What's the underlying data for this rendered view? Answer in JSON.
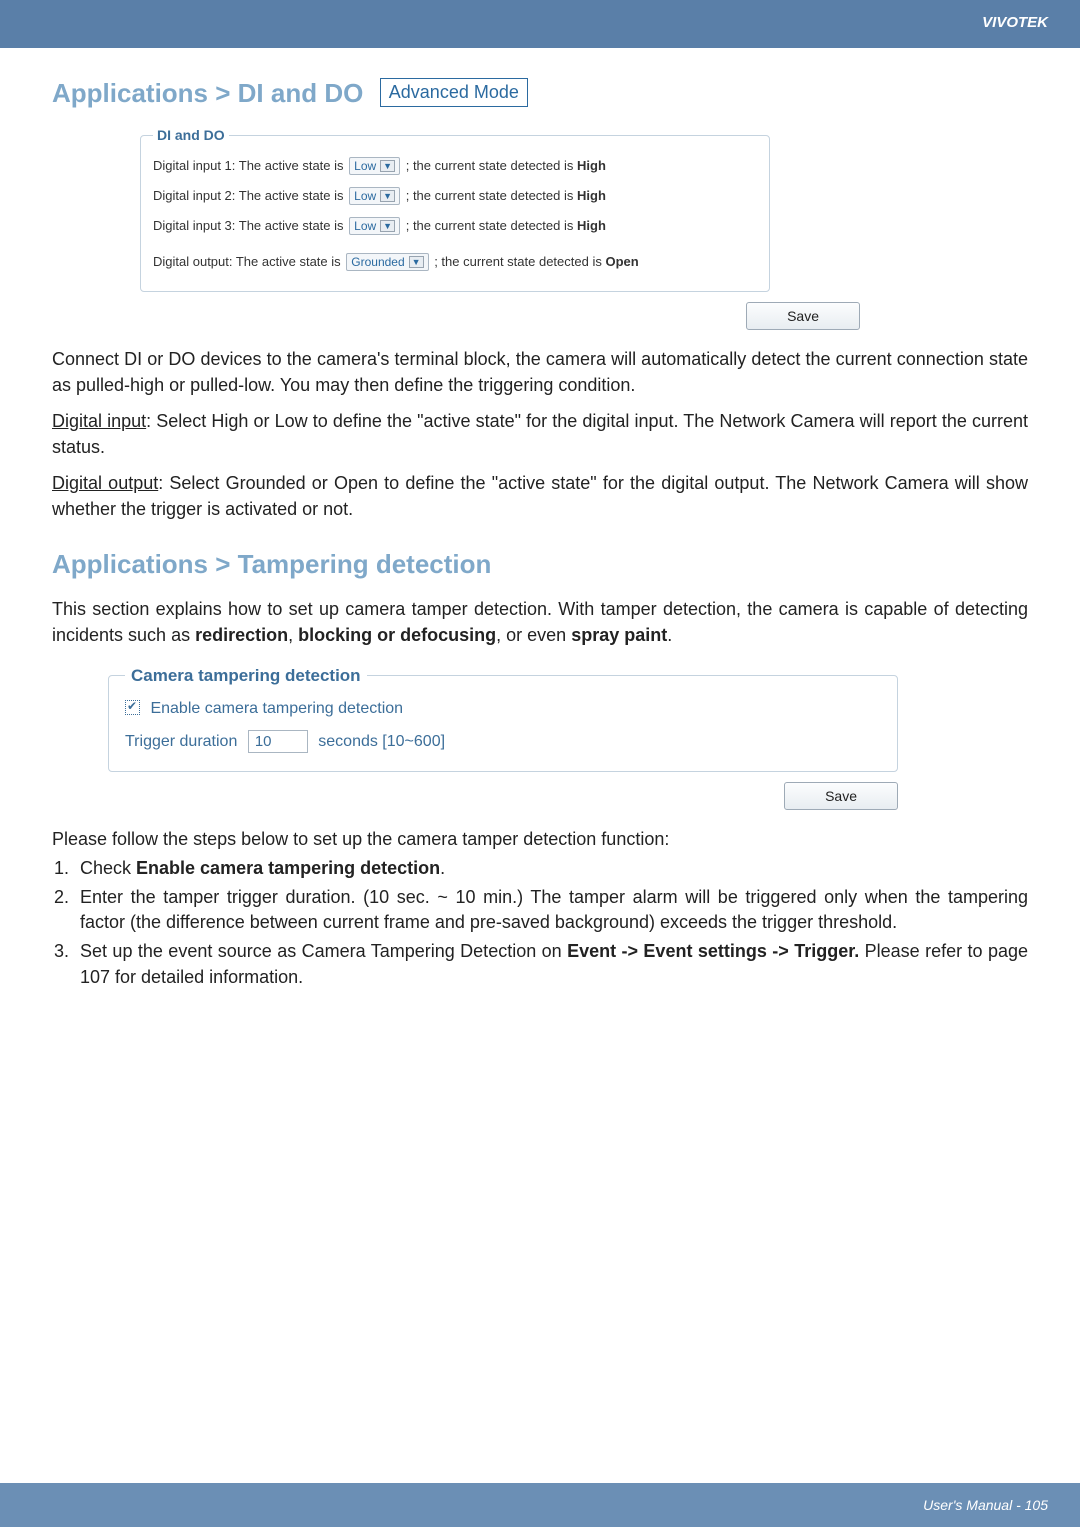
{
  "brand": "VIVOTEK",
  "section1": {
    "breadcrumb": "Applications > DI and DO",
    "mode": "Advanced Mode",
    "legend": "DI and DO",
    "rows": [
      {
        "prefix": "Digital input 1: The active state is",
        "select": "Low",
        "suffix": "; the current state detected is",
        "state": "High"
      },
      {
        "prefix": "Digital input 2: The active state is",
        "select": "Low",
        "suffix": "; the current state detected is",
        "state": "High"
      },
      {
        "prefix": "Digital input 3: The active state is",
        "select": "Low",
        "suffix": "; the current state detected is",
        "state": "High"
      },
      {
        "prefix": "Digital output: The active state is",
        "select": "Grounded",
        "suffix": "; the current state detected is",
        "state": "Open"
      }
    ],
    "save": "Save"
  },
  "para1": "Connect DI or DO devices to the camera's terminal block, the camera will automatically detect the current connection state as pulled-high or pulled-low. You may then define the triggering condition.",
  "para2a": "Digital input",
  "para2b": ": Select High or Low to define the \"active state\" for the digital input. The Network Camera will report the current status.",
  "para3a": "Digital output",
  "para3b": ": Select Grounded or Open to define the \"active state\" for the digital output. The Network Camera will show whether the trigger is activated or not.",
  "section2": {
    "heading": "Applications > Tampering detection",
    "intro_a": "This section explains how to set up camera tamper detection. With tamper detection, the camera is capable of detecting incidents such as ",
    "intro_b1": "redirection",
    "intro_b_sep": ", ",
    "intro_b2": "blocking or defocusing",
    "intro_c": ", or even ",
    "intro_d": "spray paint",
    "intro_e": ".",
    "legend": "Camera tampering detection",
    "enable": "Enable camera tampering detection",
    "trigger_label": "Trigger duration",
    "trigger_value": "10",
    "trigger_unit": "seconds [10~600]",
    "save": "Save"
  },
  "steps_intro": "Please follow the steps below to set up the camera tamper detection function:",
  "steps": [
    {
      "a": "Check ",
      "b": "Enable camera tampering detection",
      "c": "."
    },
    {
      "a": "Enter the tamper trigger duration. (10 sec. ~ 10 min.) The tamper alarm will be triggered only when the tampering factor (the difference between current frame and pre-saved background) exceeds the trigger threshold.",
      "b": "",
      "c": ""
    },
    {
      "a": "Set up the event source as Camera Tampering Detection on ",
      "b": "Event -> Event settings -> Trigger.",
      "c": " Please refer to page 107 for detailed information."
    }
  ],
  "footer": "User's Manual - 105"
}
